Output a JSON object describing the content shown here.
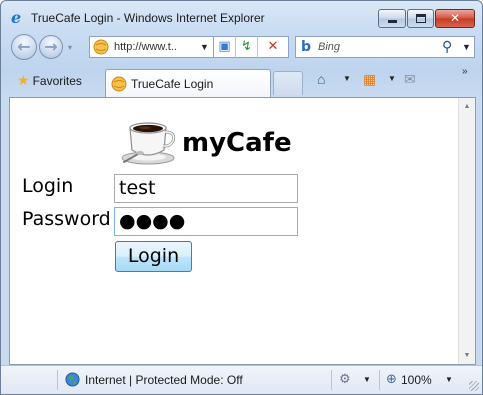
{
  "window": {
    "title": "TrueCafe Login - Windows Internet Explorer",
    "title_icon_glyph": "e",
    "minimize_icon": "minimize-icon",
    "maximize_icon": "maximize-icon",
    "close_glyph": "✕"
  },
  "navigation": {
    "back_glyph": "←",
    "forward_glyph": "→",
    "dropdown_glyph": "▾",
    "address_url": "http://www.t..",
    "address_dropdown_glyph": "▼",
    "compat_glyph": "▣",
    "refresh_glyph": "↯",
    "stop_glyph": "✕",
    "search_logo_glyph": "b",
    "search_placeholder": "Bing",
    "search_go_glyph": "⚲",
    "search_dropdown_glyph": "▼"
  },
  "favorites_bar": {
    "favorites_star": "★",
    "favorites_label": "Favorites",
    "tab_label": "TrueCafe Login",
    "home_glyph": "⌂",
    "feeds_glyph": "▦",
    "mail_glyph": "✉",
    "dropdown_glyph": "▼",
    "chevron_glyph": "»"
  },
  "page": {
    "brand": "myCafe",
    "login_label": "Login",
    "password_label": "Password",
    "login_value": "test",
    "password_value": "●●●●",
    "login_button": "Login"
  },
  "scrollbar": {
    "up_glyph": "▲",
    "down_glyph": "▼"
  },
  "status": {
    "zone_text": "Internet | Protected Mode: Off",
    "security_glyph": "⚙",
    "dropdown_glyph": "▼",
    "zoom_glyph": "⊕",
    "zoom_level": "100%"
  },
  "colors": {
    "frame_blue": "#c9dcf2",
    "button_blue": "#bee6fd",
    "close_red": "#c63a24"
  }
}
